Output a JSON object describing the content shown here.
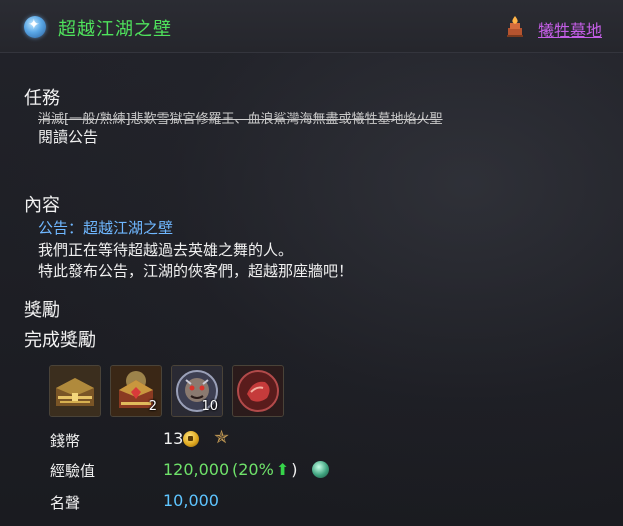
{
  "header": {
    "title": "超越江湖之壁",
    "region_link": "犧牲墓地",
    "icons": {
      "quest": "quest-crystal-icon",
      "region": "fire-shrine-icon"
    }
  },
  "task": {
    "heading": "任務",
    "struck_line": "消滅[一般/熟練]悲歎雪獄宮修羅王、血浪鯊灣海無盡或犧牲墓地焰火聖",
    "line": "閱讀公告"
  },
  "content": {
    "heading": "內容",
    "link": "公告：超越江湖之壁",
    "lines": [
      "我們正在等待超越過去英雄之舞的人。",
      "特此發布公告，江湖的俠客們，超越那座牆吧！"
    ]
  },
  "rewards": {
    "heading": "獎勵",
    "complete_heading": "完成獎勵",
    "items": [
      {
        "icon": "treasure-chest-icon",
        "count": ""
      },
      {
        "icon": "ornate-chest-icon",
        "count": "2"
      },
      {
        "icon": "demon-face-icon",
        "count": "10"
      },
      {
        "icon": "red-orb-icon",
        "count": ""
      }
    ],
    "money_label": "錢幣",
    "money_value": "13",
    "exp_label": "經驗值",
    "exp_value": "120,000",
    "exp_bonus_open": "(20%",
    "exp_bonus_close": ")",
    "fame_label": "名聲",
    "fame_value": "10,000"
  },
  "colors": {
    "title": "#4fe25c",
    "region_link": "#c45ee6",
    "link": "#6fb7ff",
    "exp": "#6fe26a",
    "fame": "#5ec5ff"
  }
}
